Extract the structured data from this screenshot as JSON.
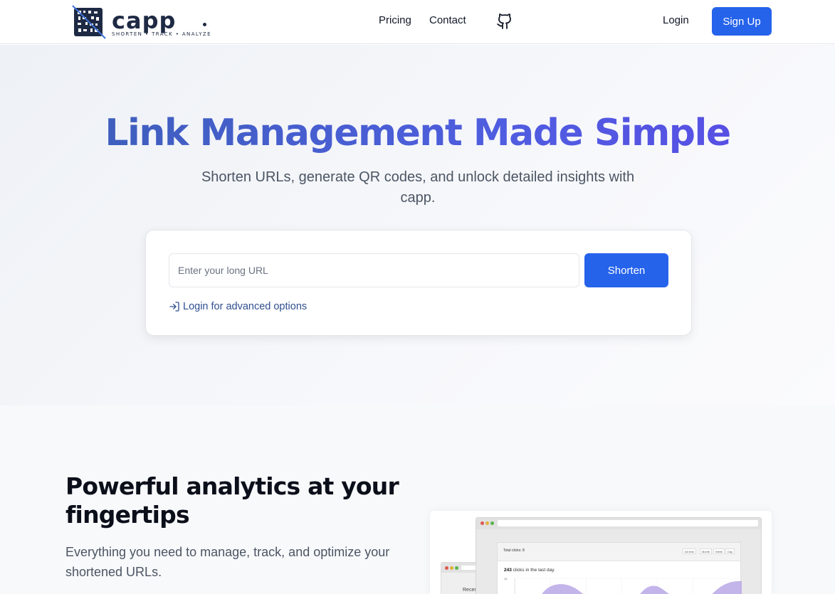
{
  "header": {
    "logo": {
      "name": "capp",
      "tagline": "SHORTEN • TRACK • ANALYZE"
    },
    "nav": {
      "pricing": "Pricing",
      "contact": "Contact"
    },
    "login": "Login",
    "signup": "Sign Up"
  },
  "hero": {
    "title": "Link Management Made Simple",
    "subtitle": "Shorten URLs, generate QR codes, and unlock detailed insights with capp.",
    "input_placeholder": "Enter your long URL",
    "input_value": "",
    "shorten_button": "Shorten",
    "advanced_link": "Login for advanced options"
  },
  "features": {
    "title": "Powerful analytics at your fingertips",
    "description": "Everything you need to manage, track, and optimize your shortened URLs."
  },
  "mock": {
    "total_clicks_label": "Total clicks: 8",
    "tabs": [
      "All time",
      "Month",
      "Week",
      "Day"
    ],
    "clicks_count": "243",
    "clicks_label": "clicks in the last day.",
    "axis_tick": "10",
    "back_label": "Recen"
  },
  "colors": {
    "primary": "#2563eb",
    "logo_dark": "#1e2a44",
    "logo_accent": "#3b6fd6",
    "chart_fill": "#b9a7e6"
  }
}
